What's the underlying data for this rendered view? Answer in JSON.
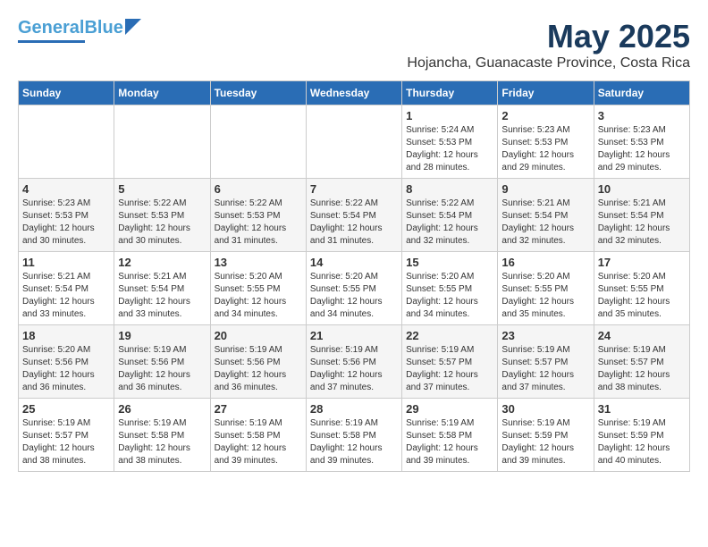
{
  "header": {
    "logo_line1": "General",
    "logo_line2": "Blue",
    "month": "May 2025",
    "location": "Hojancha, Guanacaste Province, Costa Rica"
  },
  "weekdays": [
    "Sunday",
    "Monday",
    "Tuesday",
    "Wednesday",
    "Thursday",
    "Friday",
    "Saturday"
  ],
  "weeks": [
    [
      {
        "day": "",
        "info": ""
      },
      {
        "day": "",
        "info": ""
      },
      {
        "day": "",
        "info": ""
      },
      {
        "day": "",
        "info": ""
      },
      {
        "day": "1",
        "info": "Sunrise: 5:24 AM\nSunset: 5:53 PM\nDaylight: 12 hours\nand 28 minutes."
      },
      {
        "day": "2",
        "info": "Sunrise: 5:23 AM\nSunset: 5:53 PM\nDaylight: 12 hours\nand 29 minutes."
      },
      {
        "day": "3",
        "info": "Sunrise: 5:23 AM\nSunset: 5:53 PM\nDaylight: 12 hours\nand 29 minutes."
      }
    ],
    [
      {
        "day": "4",
        "info": "Sunrise: 5:23 AM\nSunset: 5:53 PM\nDaylight: 12 hours\nand 30 minutes."
      },
      {
        "day": "5",
        "info": "Sunrise: 5:22 AM\nSunset: 5:53 PM\nDaylight: 12 hours\nand 30 minutes."
      },
      {
        "day": "6",
        "info": "Sunrise: 5:22 AM\nSunset: 5:53 PM\nDaylight: 12 hours\nand 31 minutes."
      },
      {
        "day": "7",
        "info": "Sunrise: 5:22 AM\nSunset: 5:54 PM\nDaylight: 12 hours\nand 31 minutes."
      },
      {
        "day": "8",
        "info": "Sunrise: 5:22 AM\nSunset: 5:54 PM\nDaylight: 12 hours\nand 32 minutes."
      },
      {
        "day": "9",
        "info": "Sunrise: 5:21 AM\nSunset: 5:54 PM\nDaylight: 12 hours\nand 32 minutes."
      },
      {
        "day": "10",
        "info": "Sunrise: 5:21 AM\nSunset: 5:54 PM\nDaylight: 12 hours\nand 32 minutes."
      }
    ],
    [
      {
        "day": "11",
        "info": "Sunrise: 5:21 AM\nSunset: 5:54 PM\nDaylight: 12 hours\nand 33 minutes."
      },
      {
        "day": "12",
        "info": "Sunrise: 5:21 AM\nSunset: 5:54 PM\nDaylight: 12 hours\nand 33 minutes."
      },
      {
        "day": "13",
        "info": "Sunrise: 5:20 AM\nSunset: 5:55 PM\nDaylight: 12 hours\nand 34 minutes."
      },
      {
        "day": "14",
        "info": "Sunrise: 5:20 AM\nSunset: 5:55 PM\nDaylight: 12 hours\nand 34 minutes."
      },
      {
        "day": "15",
        "info": "Sunrise: 5:20 AM\nSunset: 5:55 PM\nDaylight: 12 hours\nand 34 minutes."
      },
      {
        "day": "16",
        "info": "Sunrise: 5:20 AM\nSunset: 5:55 PM\nDaylight: 12 hours\nand 35 minutes."
      },
      {
        "day": "17",
        "info": "Sunrise: 5:20 AM\nSunset: 5:55 PM\nDaylight: 12 hours\nand 35 minutes."
      }
    ],
    [
      {
        "day": "18",
        "info": "Sunrise: 5:20 AM\nSunset: 5:56 PM\nDaylight: 12 hours\nand 36 minutes."
      },
      {
        "day": "19",
        "info": "Sunrise: 5:19 AM\nSunset: 5:56 PM\nDaylight: 12 hours\nand 36 minutes."
      },
      {
        "day": "20",
        "info": "Sunrise: 5:19 AM\nSunset: 5:56 PM\nDaylight: 12 hours\nand 36 minutes."
      },
      {
        "day": "21",
        "info": "Sunrise: 5:19 AM\nSunset: 5:56 PM\nDaylight: 12 hours\nand 37 minutes."
      },
      {
        "day": "22",
        "info": "Sunrise: 5:19 AM\nSunset: 5:57 PM\nDaylight: 12 hours\nand 37 minutes."
      },
      {
        "day": "23",
        "info": "Sunrise: 5:19 AM\nSunset: 5:57 PM\nDaylight: 12 hours\nand 37 minutes."
      },
      {
        "day": "24",
        "info": "Sunrise: 5:19 AM\nSunset: 5:57 PM\nDaylight: 12 hours\nand 38 minutes."
      }
    ],
    [
      {
        "day": "25",
        "info": "Sunrise: 5:19 AM\nSunset: 5:57 PM\nDaylight: 12 hours\nand 38 minutes."
      },
      {
        "day": "26",
        "info": "Sunrise: 5:19 AM\nSunset: 5:58 PM\nDaylight: 12 hours\nand 38 minutes."
      },
      {
        "day": "27",
        "info": "Sunrise: 5:19 AM\nSunset: 5:58 PM\nDaylight: 12 hours\nand 39 minutes."
      },
      {
        "day": "28",
        "info": "Sunrise: 5:19 AM\nSunset: 5:58 PM\nDaylight: 12 hours\nand 39 minutes."
      },
      {
        "day": "29",
        "info": "Sunrise: 5:19 AM\nSunset: 5:58 PM\nDaylight: 12 hours\nand 39 minutes."
      },
      {
        "day": "30",
        "info": "Sunrise: 5:19 AM\nSunset: 5:59 PM\nDaylight: 12 hours\nand 39 minutes."
      },
      {
        "day": "31",
        "info": "Sunrise: 5:19 AM\nSunset: 5:59 PM\nDaylight: 12 hours\nand 40 minutes."
      }
    ]
  ]
}
